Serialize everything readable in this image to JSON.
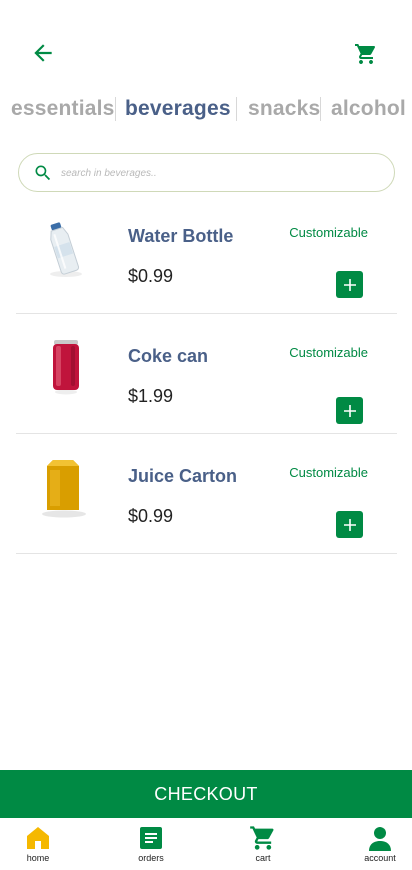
{
  "header": {
    "back_icon": "arrow-left-icon",
    "cart_icon": "shopping-cart-icon"
  },
  "categories": [
    {
      "label": "essentials",
      "active": false
    },
    {
      "label": "beverages",
      "active": true
    },
    {
      "label": "snacks",
      "active": false
    },
    {
      "label": "alcohol",
      "active": false
    }
  ],
  "search": {
    "placeholder": "search in beverages..",
    "value": "",
    "icon": "search-icon"
  },
  "products": [
    {
      "name": "Water Bottle",
      "price": "$0.99",
      "tag": "Customizable",
      "image": "water-bottle-image"
    },
    {
      "name": "Coke can",
      "price": "$1.99",
      "tag": "Customizable",
      "image": "soda-can-image"
    },
    {
      "name": "Juice Carton",
      "price": "$0.99",
      "tag": "Customizable",
      "image": "juice-carton-image"
    }
  ],
  "checkout": {
    "label": "CHECKOUT"
  },
  "bottom_nav": [
    {
      "label": "home",
      "icon": "home-icon",
      "active": true
    },
    {
      "label": "orders",
      "icon": "orders-icon",
      "active": false
    },
    {
      "label": "cart",
      "icon": "cart-icon",
      "active": false
    },
    {
      "label": "account",
      "icon": "account-icon",
      "active": false
    }
  ],
  "colors": {
    "brand_green": "#008a44",
    "category_active": "#4a6088",
    "category_inactive": "#a9a9a9",
    "home_active": "#f5b800"
  }
}
